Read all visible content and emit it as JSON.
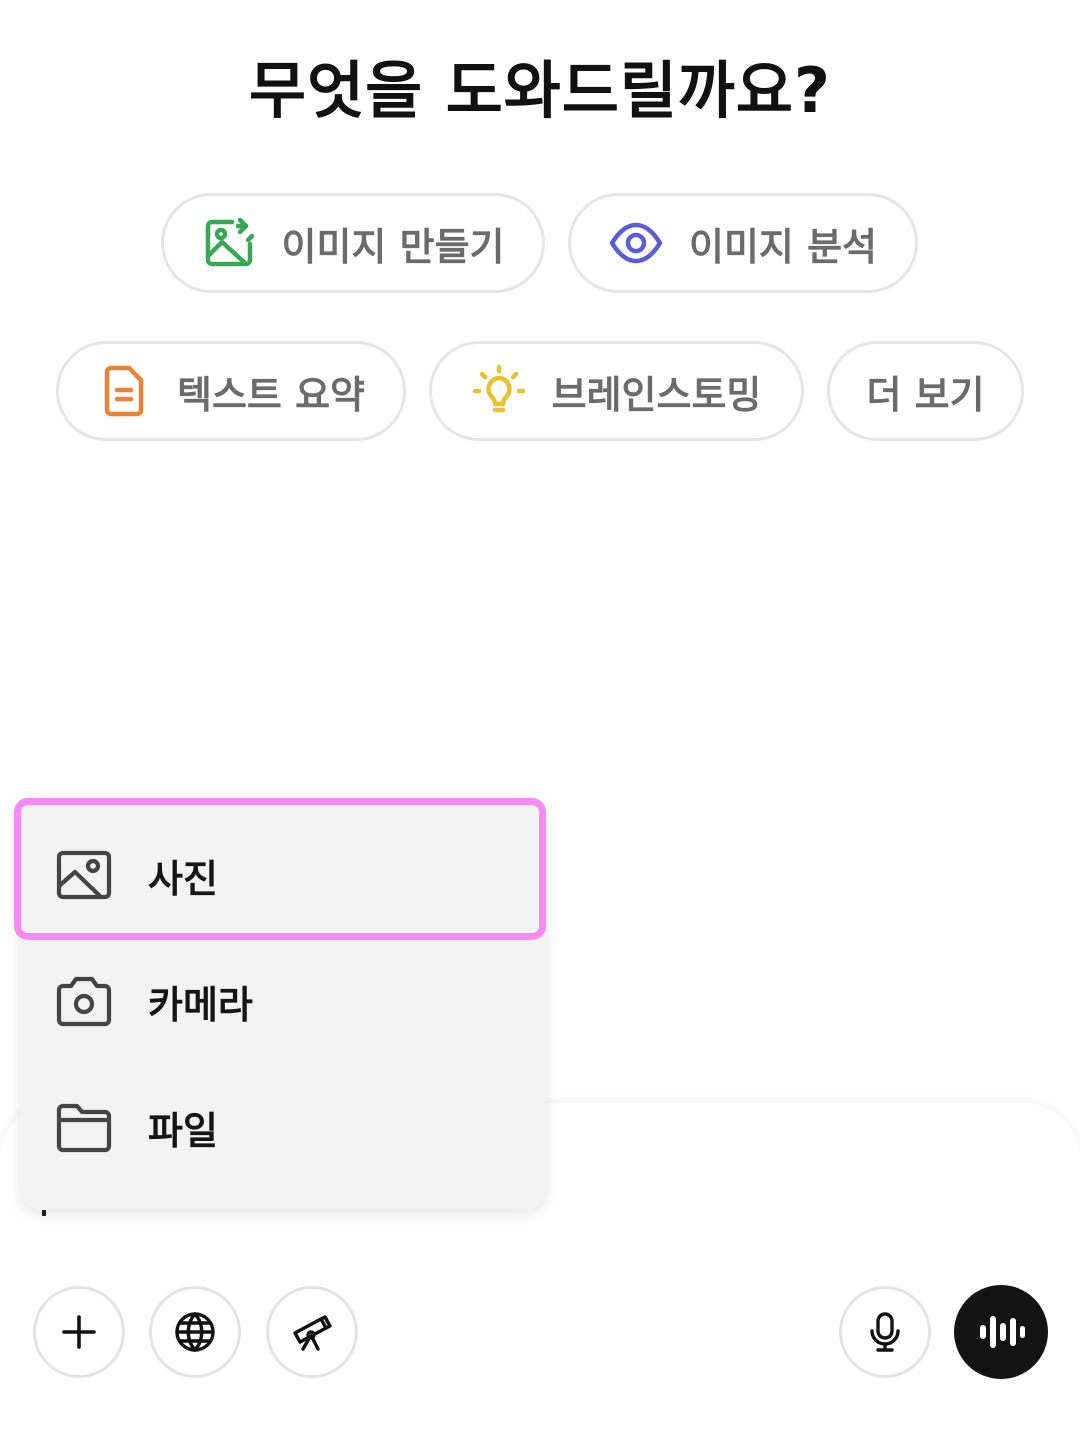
{
  "header": {
    "title": "무엇을 도와드릴까요?"
  },
  "suggestions": [
    {
      "label": "이미지 만들기",
      "icon": "image-generate-icon",
      "color": "#3aa757"
    },
    {
      "label": "이미지 분석",
      "icon": "eye-icon",
      "color": "#5b5bd6"
    },
    {
      "label": "텍스트 요약",
      "icon": "document-icon",
      "color": "#e8833a"
    },
    {
      "label": "브레인스토밍",
      "icon": "lightbulb-icon",
      "color": "#e6c230"
    },
    {
      "label": "더 보기",
      "icon": "",
      "color": ""
    }
  ],
  "attach_menu": {
    "items": [
      {
        "label": "사진",
        "icon": "photo-icon"
      },
      {
        "label": "카메라",
        "icon": "camera-icon"
      },
      {
        "label": "파일",
        "icon": "folder-icon"
      }
    ],
    "highlight_color": "#f78af3"
  },
  "composer": {
    "buttons": [
      {
        "icon": "plus-icon"
      },
      {
        "icon": "globe-icon"
      },
      {
        "icon": "telescope-icon"
      },
      {
        "icon": "microphone-icon"
      },
      {
        "icon": "voice-waveform-icon"
      }
    ]
  }
}
